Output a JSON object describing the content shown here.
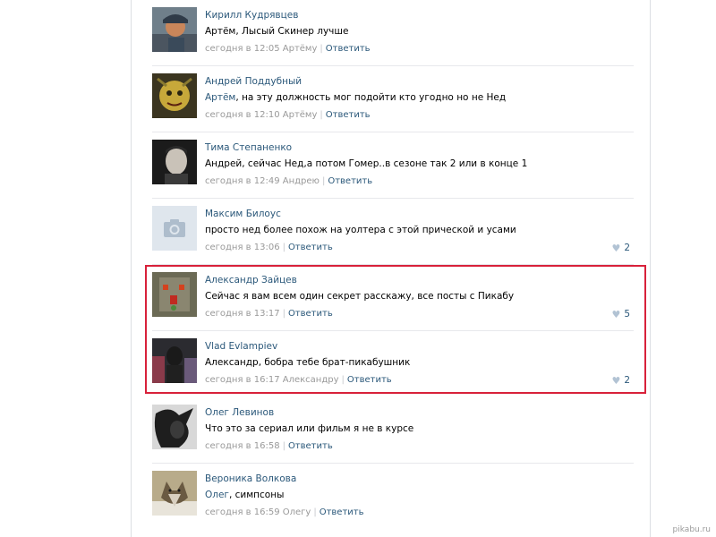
{
  "comments": [
    {
      "author": "Кирилл Кудрявцев",
      "mention": "",
      "text": "Артём, Лысый Скинер лучше",
      "time": "сегодня в 12:05",
      "reply_to": "Артёму",
      "reply_label": "Ответить",
      "likes": ""
    },
    {
      "author": "Андрей Поддубный",
      "mention": "Артём",
      "text": ", на эту должность мог подойти кто угодно но не Нед",
      "time": "сегодня в 12:10",
      "reply_to": "Артёму",
      "reply_label": "Ответить",
      "likes": ""
    },
    {
      "author": "Тима Степаненко",
      "mention": "",
      "text": "Андрей, сейчас Нед,а потом Гомер..в сезоне так 2 или в конце 1",
      "time": "сегодня в 12:49",
      "reply_to": "Андрею",
      "reply_label": "Ответить",
      "likes": ""
    },
    {
      "author": "Максим Билоус",
      "mention": "",
      "text": "просто нед более похож на уолтера с этой прической и усами",
      "time": "сегодня в 13:06",
      "reply_to": "",
      "reply_label": "Ответить",
      "likes": "2"
    },
    {
      "author": "Александр Зайцев",
      "mention": "",
      "text": "Сейчас я вам всем один секрет расскажу, все посты с Пикабу",
      "time": "сегодня в 13:17",
      "reply_to": "",
      "reply_label": "Ответить",
      "likes": "5"
    },
    {
      "author": "Vlad Evlampiev",
      "mention": "",
      "text": "Александр, бобра тебе брат-пикабушник",
      "time": "сегодня в 16:17",
      "reply_to": "Александру",
      "reply_label": "Ответить",
      "likes": "2"
    },
    {
      "author": "Олег Левинов",
      "mention": "",
      "text": "Что это за сериал или фильм я не в курсе",
      "time": "сегодня в 16:58",
      "reply_to": "",
      "reply_label": "Ответить",
      "likes": ""
    },
    {
      "author": "Вероника Волкова",
      "mention": "Олег",
      "text": ", симпсоны",
      "time": "сегодня в 16:59",
      "reply_to": "Олегу",
      "reply_label": "Ответить",
      "likes": ""
    }
  ],
  "watermark": "pikabu.ru",
  "colors": {
    "link": "#2b587a",
    "meta": "#999999",
    "highlight": "#d8213a"
  },
  "icons": {
    "like": "heart-icon",
    "no_photo": "camera-icon"
  }
}
